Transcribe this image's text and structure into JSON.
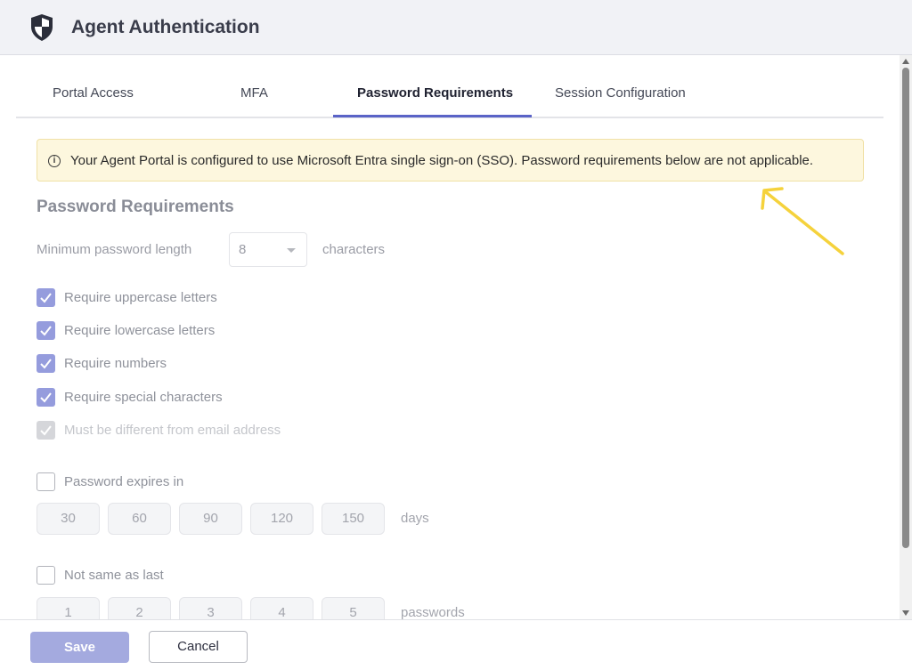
{
  "header": {
    "title": "Agent Authentication",
    "icon": "shield-icon"
  },
  "tabs": [
    {
      "label": "Portal Access",
      "active": false
    },
    {
      "label": "MFA",
      "active": false
    },
    {
      "label": "Password Requirements",
      "active": true
    },
    {
      "label": "Session Configuration",
      "active": false
    }
  ],
  "banner": {
    "message": "Your Agent Portal is configured to use Microsoft Entra single sign-on (SSO). Password requirements below are not applicable.",
    "icon": "info-icon"
  },
  "section": {
    "title": "Password Requirements"
  },
  "min_length": {
    "label": "Minimum password length",
    "value": "8",
    "unit": "characters"
  },
  "rules": [
    {
      "label": "Require uppercase letters",
      "checked": true
    },
    {
      "label": "Require lowercase letters",
      "checked": true
    },
    {
      "label": "Require numbers",
      "checked": true
    },
    {
      "label": "Require special characters",
      "checked": true
    },
    {
      "label": "Must be different from email address",
      "checked": true
    }
  ],
  "expiry": {
    "label": "Password expires in",
    "checked": false,
    "options": [
      "30",
      "60",
      "90",
      "120",
      "150"
    ],
    "unit": "days"
  },
  "history": {
    "label": "Not same as last",
    "checked": false,
    "options": [
      "1",
      "2",
      "3",
      "4",
      "5"
    ],
    "unit": "passwords"
  },
  "footer": {
    "save_label": "Save",
    "cancel_label": "Cancel"
  },
  "colors": {
    "accent": "#5a63c7",
    "banner_bg": "#fdf7de",
    "annotation_arrow": "#f5d23c"
  }
}
